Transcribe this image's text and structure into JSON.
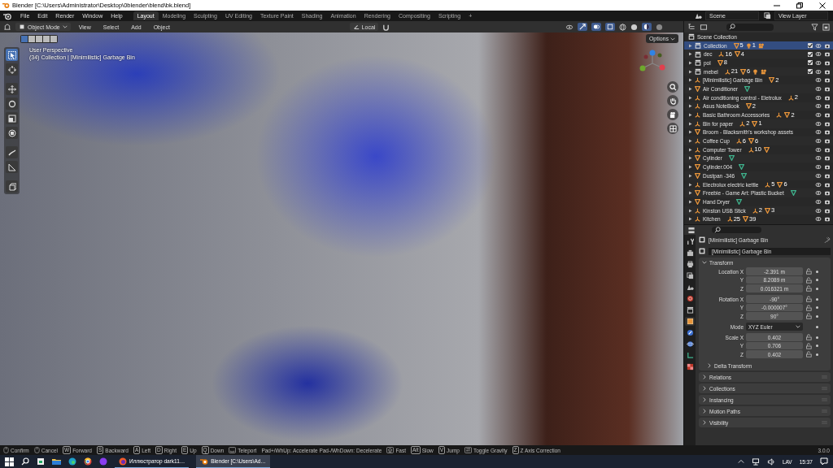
{
  "window": {
    "title": "Blender [C:\\Users\\Administrator\\Desktop\\0blender\\blend\\bk.blend]"
  },
  "menus": [
    "File",
    "Edit",
    "Render",
    "Window",
    "Help"
  ],
  "workspaces": [
    {
      "label": "Layout",
      "selected": true
    },
    {
      "label": "Modeling",
      "selected": false
    },
    {
      "label": "Sculpting",
      "selected": false
    },
    {
      "label": "UV Editing",
      "selected": false
    },
    {
      "label": "Texture Paint",
      "selected": false
    },
    {
      "label": "Shading",
      "selected": false
    },
    {
      "label": "Animation",
      "selected": false
    },
    {
      "label": "Rendering",
      "selected": false
    },
    {
      "label": "Compositing",
      "selected": false
    },
    {
      "label": "Scripting",
      "selected": false
    }
  ],
  "add_workspace": "+",
  "scene": "Scene",
  "view_layer": "View Layer",
  "viewport_header": {
    "mode": "Object Mode",
    "menus": [
      "View",
      "Select",
      "Add",
      "Object"
    ],
    "orientation": "Local",
    "options": "Options"
  },
  "viewport": {
    "perspective": "User Perspective",
    "info": "(34) Collection | [Minimilistic] Garbage Bin"
  },
  "outliner": {
    "root": "Scene Collection",
    "items": [
      {
        "name": "Collection",
        "kind": "collection",
        "selected": true,
        "checked": true,
        "badges": [
          {
            "kind": "mesh",
            "count": "5"
          },
          {
            "kind": "light",
            "count": "1"
          },
          {
            "kind": "camera"
          }
        ]
      },
      {
        "name": "dec",
        "kind": "collection",
        "selected": false,
        "checked": true,
        "badges": [
          {
            "kind": "empty",
            "count": "16"
          },
          {
            "kind": "mesh",
            "count": "4"
          }
        ]
      },
      {
        "name": "pol",
        "kind": "collection",
        "selected": false,
        "checked": true,
        "badges": [
          {
            "kind": "mesh",
            "count": "8"
          }
        ]
      },
      {
        "name": "mebel",
        "kind": "collection",
        "selected": false,
        "checked": true,
        "badges": [
          {
            "kind": "empty",
            "count": "21"
          },
          {
            "kind": "mesh",
            "count": "6"
          },
          {
            "kind": "light"
          },
          {
            "kind": "camera"
          }
        ]
      },
      {
        "name": "[Minimilistic] Garbage Bin",
        "kind": "empty",
        "selected": false,
        "badges": [
          {
            "kind": "mesh",
            "count": "2"
          }
        ]
      },
      {
        "name": "Air Conditioner",
        "kind": "mesh",
        "selected": false,
        "badges": [
          {
            "kind": "meshdata"
          }
        ]
      },
      {
        "name": "Air conditioning control - Eletrolux",
        "kind": "empty",
        "selected": false,
        "badges": [
          {
            "kind": "empty",
            "count": "2"
          }
        ]
      },
      {
        "name": "Asus NoteBook",
        "kind": "empty",
        "selected": false,
        "badges": [
          {
            "kind": "mesh",
            "count": "2"
          }
        ]
      },
      {
        "name": "Basic Bathroom Accessories",
        "kind": "empty",
        "selected": false,
        "badges": [
          {
            "kind": "empty"
          },
          {
            "kind": "mesh",
            "count": "2"
          }
        ]
      },
      {
        "name": "Bin for paper",
        "kind": "empty",
        "selected": false,
        "badges": [
          {
            "kind": "empty",
            "count": "2"
          },
          {
            "kind": "mesh",
            "count": "1"
          }
        ]
      },
      {
        "name": "Broom - Blacksmith's workshop assets",
        "kind": "mesh",
        "selected": false
      },
      {
        "name": "Coffee Cup",
        "kind": "empty",
        "selected": false,
        "badges": [
          {
            "kind": "empty",
            "count": "6"
          },
          {
            "kind": "mesh",
            "count": "6"
          }
        ]
      },
      {
        "name": "Computer Tower",
        "kind": "empty",
        "selected": false,
        "badges": [
          {
            "kind": "empty",
            "count": "10"
          },
          {
            "kind": "mesh"
          }
        ]
      },
      {
        "name": "Cylinder",
        "kind": "mesh",
        "selected": false,
        "badges": [
          {
            "kind": "meshdata"
          }
        ]
      },
      {
        "name": "Cylinder.004",
        "kind": "mesh",
        "selected": false,
        "badges": [
          {
            "kind": "meshdata"
          }
        ]
      },
      {
        "name": "Dustpan -346",
        "kind": "mesh",
        "selected": false,
        "badges": [
          {
            "kind": "meshdata"
          }
        ]
      },
      {
        "name": "Electrolux electric kettle",
        "kind": "empty",
        "selected": false,
        "badges": [
          {
            "kind": "empty",
            "count": "5"
          },
          {
            "kind": "mesh",
            "count": "6"
          }
        ]
      },
      {
        "name": "Freebie - Game Art: Plastic Bucket",
        "kind": "mesh",
        "selected": false,
        "badges": [
          {
            "kind": "meshdata"
          }
        ]
      },
      {
        "name": "Hand Dryer",
        "kind": "mesh",
        "selected": false,
        "badges": [
          {
            "kind": "meshdata"
          }
        ]
      },
      {
        "name": "Kinston USB Stick",
        "kind": "empty",
        "selected": false,
        "badges": [
          {
            "kind": "empty",
            "count": "2"
          },
          {
            "kind": "mesh",
            "count": "3"
          }
        ]
      },
      {
        "name": "Kitchen",
        "kind": "empty",
        "selected": false,
        "badges": [
          {
            "kind": "empty",
            "count": "25"
          },
          {
            "kind": "mesh",
            "count": "39"
          }
        ]
      }
    ]
  },
  "properties": {
    "tabs": [
      {
        "kind": "tool",
        "selected": false
      },
      {
        "kind": "render",
        "selected": false
      },
      {
        "kind": "output",
        "selected": false
      },
      {
        "kind": "view_layer",
        "selected": false
      },
      {
        "kind": "scene",
        "selected": false
      },
      {
        "kind": "world",
        "selected": false
      },
      {
        "kind": "collection",
        "selected": false
      },
      {
        "kind": "object",
        "selected": true
      },
      {
        "kind": "modifier",
        "selected": false
      },
      {
        "kind": "physics",
        "selected": false
      },
      {
        "kind": "data",
        "selected": false
      },
      {
        "kind": "texture",
        "selected": false
      }
    ],
    "object_name": "[Minimilistic] Garbage Bin",
    "data_name": "[Minimilistic] Garbage Bin",
    "transform": {
      "label": "Transform",
      "expanded": true,
      "location": {
        "label": "Location",
        "fields": [
          {
            "axis": "X",
            "value": "-2.391 m"
          },
          {
            "axis": "Y",
            "value": "8.2089 m"
          },
          {
            "axis": "Z",
            "value": "0.016321 m"
          }
        ]
      },
      "rotation": {
        "label": "Rotation",
        "fields": [
          {
            "axis": "X",
            "value": "-90°"
          },
          {
            "axis": "Y",
            "value": "-0.000007°"
          },
          {
            "axis": "Z",
            "value": "90°"
          }
        ]
      },
      "mode_label": "Mode",
      "mode": "XYZ Euler",
      "scale": {
        "label": "Scale",
        "fields": [
          {
            "axis": "X",
            "value": "0.402"
          },
          {
            "axis": "Y",
            "value": "0.706"
          },
          {
            "axis": "Z",
            "value": "0.402"
          }
        ]
      },
      "delta": {
        "label": "Delta Transform",
        "expanded": false
      }
    },
    "panels": [
      {
        "label": "Relations",
        "expanded": false
      },
      {
        "label": "Collections",
        "expanded": false
      },
      {
        "label": "Instancing",
        "expanded": false
      },
      {
        "label": "Motion Paths",
        "expanded": false
      },
      {
        "label": "Visibility",
        "expanded": false
      }
    ]
  },
  "status_bar": {
    "hints": [
      {
        "kind": "mouse",
        "label": "Confirm"
      },
      {
        "kind": "mouse",
        "label": "Cancel"
      },
      {
        "kind": "key",
        "key": "W",
        "label": "Forward"
      },
      {
        "kind": "key",
        "key": "S",
        "label": "Backward"
      },
      {
        "kind": "key",
        "key": "A",
        "label": "Left"
      },
      {
        "kind": "key",
        "key": "D",
        "label": "Right"
      },
      {
        "kind": "key",
        "key": "E",
        "label": "Up"
      },
      {
        "kind": "key",
        "key": "Q",
        "label": "Down"
      },
      {
        "kind": "space",
        "label": "Teleport"
      },
      {
        "kind": "text",
        "label": "Pad+/WhUp: Accelerate Pad-/WhDown: Decelerate"
      },
      {
        "kind": "shift",
        "label": "Fast"
      },
      {
        "kind": "key",
        "key": "Alt",
        "label": "Slow"
      },
      {
        "kind": "key",
        "key": "V",
        "label": "Jump"
      },
      {
        "kind": "tab",
        "label": "Toggle Gravity"
      },
      {
        "kind": "key",
        "key": "Z",
        "label": "Z Axis Correction"
      }
    ],
    "version": "3.0.0"
  },
  "taskbar": {
    "tasks": [
      {
        "kind": "firefox",
        "label": "Иллюстратор dark11…",
        "selected": false
      },
      {
        "kind": "blender",
        "label": "Blender [C:\\Users\\Ad…",
        "selected": true
      }
    ],
    "language": "LAV",
    "time": "15:37"
  }
}
